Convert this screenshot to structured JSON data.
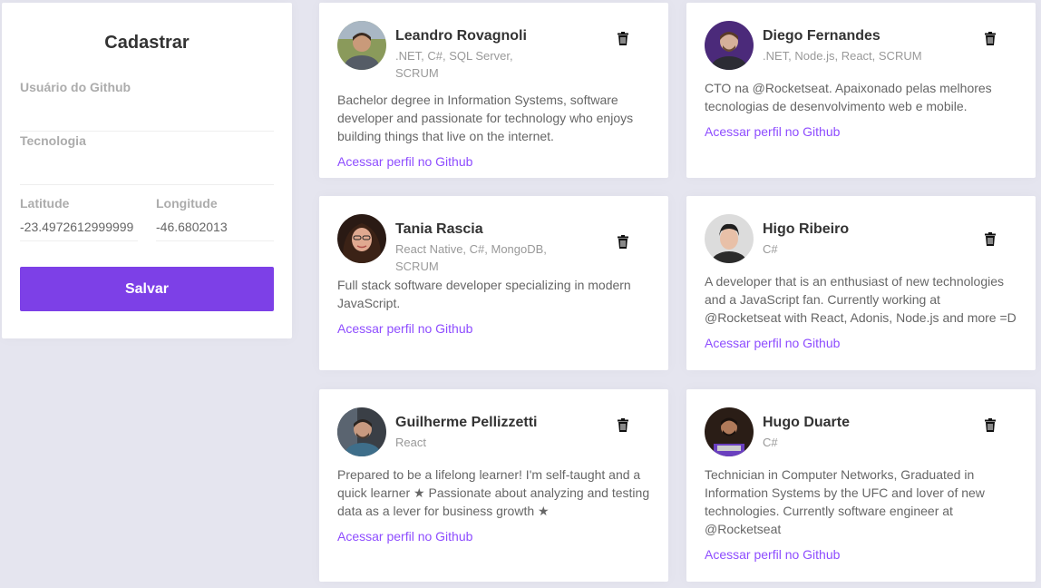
{
  "form": {
    "title": "Cadastrar",
    "github_username": {
      "label": "Usuário do Github",
      "value": ""
    },
    "techs": {
      "label": "Tecnologia",
      "value": ""
    },
    "latitude": {
      "label": "Latitude",
      "value": "-23.4972612999999"
    },
    "longitude": {
      "label": "Longitude",
      "value": "-46.6802013"
    },
    "save_label": "Salvar"
  },
  "devs": [
    {
      "name": "Leandro Rovagnoli",
      "techs": ".NET, C#, SQL Server, SCRUM",
      "bio": "Bachelor degree in Information Systems, software developer and passionate for technology who enjoys building things that live on the internet.",
      "link": "Acessar perfil no Github",
      "avatar": {
        "bg": "#8a9a5b",
        "skin": "#c99a7a",
        "hair": "#3a2a20",
        "shirt": "#555c66"
      }
    },
    {
      "name": "Diego Fernandes",
      "techs": ".NET, Node.js, React, SCRUM",
      "bio": "CTO na @Rocketseat. Apaixonado pelas melhores tecnologias de desenvolvimento web e mobile.",
      "link": "Acessar perfil no Github",
      "avatar": {
        "bg": "#4b2a7a",
        "skin": "#d6b09a",
        "hair": "#5a3a28",
        "shirt": "#2c2c34"
      }
    },
    {
      "name": "Tania Rascia",
      "techs": "React Native, C#, MongoDB, SCRUM",
      "bio": "Full stack software developer specializing in modern JavaScript.",
      "link": "Acessar perfil no Github",
      "avatar": {
        "bg": "#2a1a14",
        "skin": "#e0a990",
        "hair": "#3b2216",
        "shirt": "#2a1a14"
      }
    },
    {
      "name": "Higo Ribeiro",
      "techs": "C#",
      "bio": "A developer that is an enthusiast of new technologies and a JavaScript fan. Currently working at @Rocketseat with React, Adonis, Node.js and more =D",
      "link": "Acessar perfil no Github",
      "avatar": {
        "bg": "#dcdcdc",
        "skin": "#e8c0a8",
        "hair": "#1e1e1e",
        "shirt": "#2b2b2b"
      }
    },
    {
      "name": "Guilherme Pellizzetti",
      "techs": "React",
      "bio": "Prepared to be a lifelong learner! I'm self-taught and a quick learner ★ Passionate about analyzing and testing data as a lever for business growth ★",
      "link": "Acessar perfil no Github",
      "avatar": {
        "bg": "#3a3f46",
        "skin": "#c89a80",
        "hair": "#2a2420",
        "shirt": "#3e6e8a"
      }
    },
    {
      "name": "Hugo Duarte",
      "techs": "C#",
      "bio": "Technician in Computer Networks, Graduated in Information Systems by the UFC and lover of new technologies. Currently software engineer at @Rocketseat",
      "link": "Acessar perfil no Github",
      "avatar": {
        "bg": "#2a1d16",
        "skin": "#b07a5a",
        "hair": "#1a120e",
        "shirt": "#6a3fbf"
      }
    }
  ],
  "colors": {
    "background": "#e5e5ef",
    "primary": "#7d40e7",
    "link": "#8e4dff"
  }
}
